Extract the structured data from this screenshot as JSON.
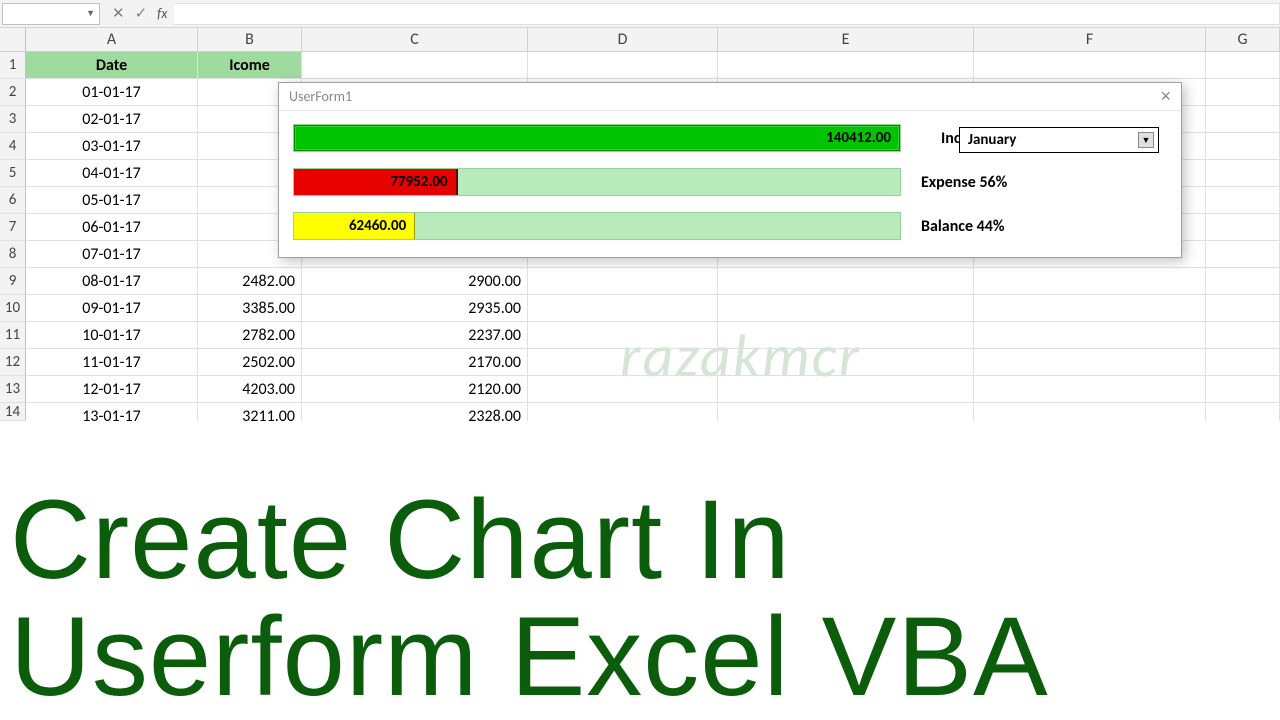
{
  "formula_bar": {
    "namebox": "",
    "fx": "fx",
    "fx_input": ""
  },
  "columns": [
    "A",
    "B",
    "C",
    "D",
    "E",
    "F",
    "G"
  ],
  "headers": {
    "A": "Date",
    "B": "Icome"
  },
  "rows": [
    {
      "n": "1",
      "A": "Date",
      "B": "Icome",
      "C": "",
      "header": true
    },
    {
      "n": "2",
      "A": "01-01-17"
    },
    {
      "n": "3",
      "A": "02-01-17"
    },
    {
      "n": "4",
      "A": "03-01-17"
    },
    {
      "n": "5",
      "A": "04-01-17"
    },
    {
      "n": "6",
      "A": "05-01-17"
    },
    {
      "n": "7",
      "A": "06-01-17"
    },
    {
      "n": "8",
      "A": "07-01-17"
    },
    {
      "n": "9",
      "A": "08-01-17",
      "B": "2482.00",
      "C": "2900.00"
    },
    {
      "n": "10",
      "A": "09-01-17",
      "B": "3385.00",
      "C": "2935.00"
    },
    {
      "n": "11",
      "A": "10-01-17",
      "B": "2782.00",
      "C": "2237.00"
    },
    {
      "n": "12",
      "A": "11-01-17",
      "B": "2502.00",
      "C": "2170.00"
    },
    {
      "n": "13",
      "A": "12-01-17",
      "B": "4203.00",
      "C": "2120.00"
    },
    {
      "n": "14",
      "A": "13-01-17",
      "B": "3211.00",
      "C": "2328.00"
    }
  ],
  "userform": {
    "title": "UserForm1",
    "income_value": "140412.00",
    "income_label": "Income",
    "expense_value": "77952.00",
    "expense_label": "Expense 56%",
    "balance_value": "62460.00",
    "balance_label": "Balance 44%",
    "month_selected": "January"
  },
  "watermark": "razakmcr",
  "title_line1": "Create Chart In",
  "title_line2": "Userform Excel VBA",
  "chart_data": {
    "type": "bar",
    "orientation": "horizontal",
    "categories": [
      "Income",
      "Expense",
      "Balance"
    ],
    "values": [
      140412.0,
      77952.0,
      62460.0
    ],
    "percent_of_income": [
      100,
      56,
      44
    ],
    "colors": [
      "#00c400",
      "#e70000",
      "#ffff00"
    ],
    "title": "UserForm1",
    "period": "January"
  }
}
